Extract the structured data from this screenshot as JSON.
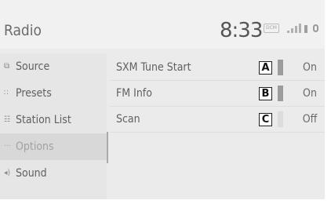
{
  "header": {
    "title": "Radio",
    "clock": "8:33",
    "status_badge": "DCM",
    "signal_icon": "signal-bars-icon",
    "battery_icon": "battery-icon"
  },
  "sidebar": {
    "items": [
      {
        "label": "Source",
        "icon": "source-icon",
        "selected": false
      },
      {
        "label": "Presets",
        "icon": "presets-icon",
        "selected": false
      },
      {
        "label": "Station List",
        "icon": "station-list-icon",
        "selected": false
      },
      {
        "label": "Options",
        "icon": "options-icon",
        "selected": true
      },
      {
        "label": "Sound",
        "icon": "sound-icon",
        "selected": false
      }
    ]
  },
  "options": {
    "rows": [
      {
        "label": "SXM Tune Start",
        "marker": "A",
        "value": "On",
        "enabled": true
      },
      {
        "label": "FM Info",
        "marker": "B",
        "value": "On",
        "enabled": true
      },
      {
        "label": "Scan",
        "marker": "C",
        "value": "Off",
        "enabled": false
      }
    ]
  },
  "colors": {
    "indicator_on": "#9c9c9c",
    "indicator_off": "#dcdcdc"
  }
}
